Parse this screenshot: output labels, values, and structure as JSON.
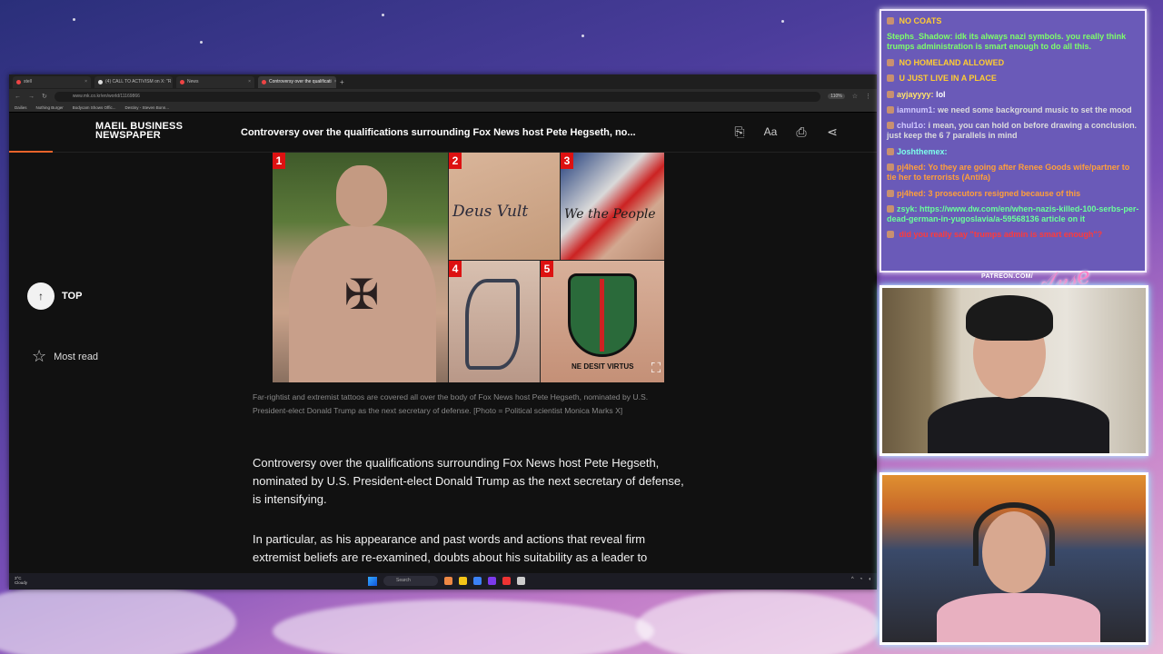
{
  "browser": {
    "tabs": [
      {
        "label": "stell",
        "active": false
      },
      {
        "label": "(4) CALL TO ACTIVISM on X: \"R",
        "active": false
      },
      {
        "label": "News",
        "active": false
      },
      {
        "label": "Controversy over the qualificati",
        "active": true
      }
    ],
    "url": "www.mk.co.kr/en/world/11169866",
    "zoom": "110%",
    "bookmarks": [
      "Dailies",
      "Nothing Burger",
      "Bodycam Shows Offic...",
      "Destiny - Steven Bonn..."
    ]
  },
  "site": {
    "logo_line1": "MAEIL BUSINESS",
    "logo_line2": "NEWSPAPER",
    "header_title": "Controversy over the qualifications surrounding Fox News host Pete Hegseth, no...",
    "header_icons": [
      "translate-icon",
      "font-size-icon",
      "print-icon",
      "share-icon"
    ],
    "scroll_progress": 0.05
  },
  "sidebar": {
    "top_label": "TOP",
    "most_read_label": "Most read"
  },
  "photo": {
    "panel_numbers": [
      "1",
      "2",
      "3",
      "4",
      "5"
    ],
    "panel2_text": "Deus Vult",
    "panel3_text": "We the People",
    "panel5_text": "NE DESIT VIRTUS"
  },
  "article": {
    "caption": "Far-rightist and extremist tattoos are covered all over the body of Fox News host Pete Hegseth, nominated by U.S. President-elect Donald Trump as the next secretary of defense. [Photo = Political scientist Monica Marks X]",
    "para1": "Controversy over the qualifications surrounding Fox News host Pete Hegseth, nominated by U.S. President-elect Donald Trump as the next secretary of defense, is intensifying.",
    "para2": "In particular, as his appearance and past words and actions that reveal firm extremist beliefs are re-examined, doubts about his suitability as a leader to"
  },
  "taskbar": {
    "weather_temp": "3°C",
    "weather_desc": "Cloudy",
    "search_label": "Search"
  },
  "chat": {
    "messages": [
      {
        "user": "",
        "text": "NO COATS",
        "color": "#ffcc33"
      },
      {
        "user": "Stephs_Shadow:",
        "text": "idk its always nazi symbols. you really think trumps administration is smart enough to do all this.",
        "color": "#7dff6a"
      },
      {
        "user": "",
        "text": "NO HOMELAND ALLOWED",
        "color": "#ffcc33"
      },
      {
        "user": "",
        "text": "U JUST LIVE IN A PLACE",
        "color": "#ffcc33"
      },
      {
        "user": "ayjayyyy:",
        "text": "lol",
        "color": "#ffffff"
      },
      {
        "user": "iamnum1:",
        "text": "we need some background music to set the mood",
        "color": "#dddddd"
      },
      {
        "user": "chul1o:",
        "text": "i mean, you can hold on before drawing a conclusion. just keep the 6 7 parallels in mind",
        "color": "#dddddd"
      },
      {
        "user": "Joshthemex:",
        "text": "",
        "color": "#7dffea"
      },
      {
        "user": "pj4hed:",
        "text": "Yo they are going after Renee Goods wife/partner to tie her to terrorists (Antifa)",
        "color": "#ff9f3a"
      },
      {
        "user": "pj4hed:",
        "text": "3 prosecutors resigned because of this",
        "color": "#ff9f3a"
      },
      {
        "user": "zsyk:",
        "text": "https://www.dw.com/en/when-nazis-killed-100-serbs-per-dead-german-in-yugoslavia/a-59568136 article on it",
        "color": "#6aff9a"
      },
      {
        "user": "",
        "text": "did you really say \"trumps admin is smart enough\"?",
        "color": "#ff3a3a"
      }
    ]
  },
  "overlay": {
    "patreon": "PATREON.COM/"
  }
}
